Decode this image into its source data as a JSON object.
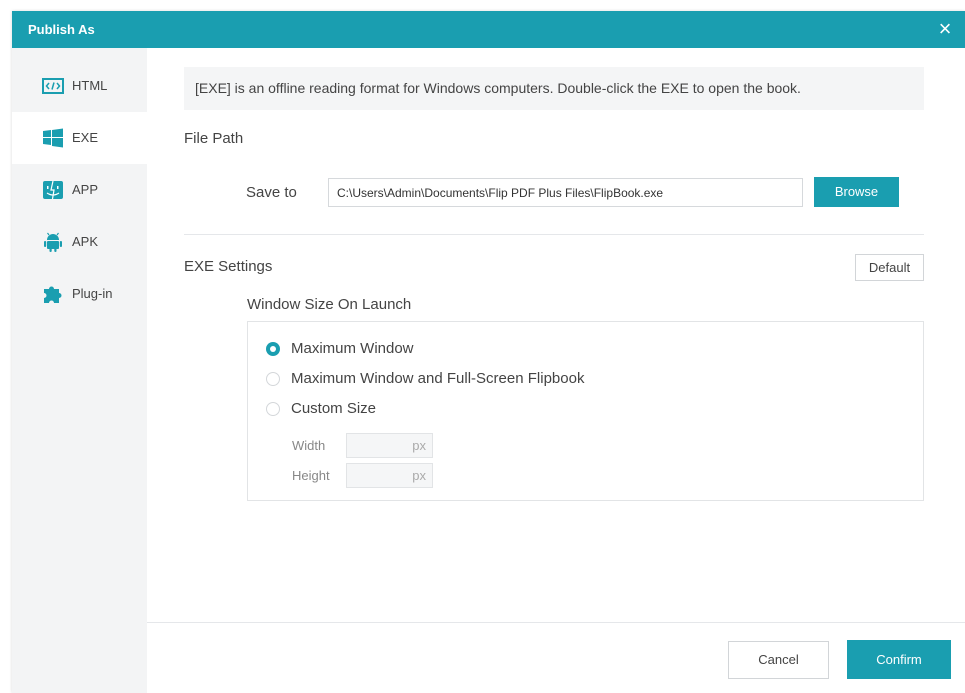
{
  "dialog": {
    "title": "Publish As",
    "close_label": "×"
  },
  "sidebar": {
    "items": [
      {
        "label": "HTML",
        "icon": "html-code-icon",
        "active": false
      },
      {
        "label": "EXE",
        "icon": "windows-icon",
        "active": true
      },
      {
        "label": "APP",
        "icon": "mac-finder-icon",
        "active": false
      },
      {
        "label": "APK",
        "icon": "android-icon",
        "active": false
      },
      {
        "label": "Plug-in",
        "icon": "puzzle-icon",
        "active": false
      }
    ]
  },
  "main": {
    "info": "[EXE] is an offline reading format for Windows computers. Double-click the EXE to open the book.",
    "file_path": {
      "title": "File Path",
      "save_label": "Save to",
      "path_value": "C:\\Users\\Admin\\Documents\\Flip PDF Plus Files\\FlipBook.exe",
      "browse_label": "Browse"
    },
    "exe_settings": {
      "title": "EXE Settings",
      "default_label": "Default",
      "window_size_title": "Window Size On Launch",
      "options": [
        {
          "label": "Maximum Window",
          "selected": true
        },
        {
          "label": "Maximum Window and Full-Screen Flipbook",
          "selected": false
        },
        {
          "label": "Custom Size",
          "selected": false
        }
      ],
      "width_label": "Width",
      "height_label": "Height",
      "width_value": "",
      "height_value": "",
      "unit": "px"
    }
  },
  "footer": {
    "cancel_label": "Cancel",
    "confirm_label": "Confirm"
  },
  "colors": {
    "accent": "#1a9eb0",
    "sidebar_bg": "#f3f4f5"
  }
}
